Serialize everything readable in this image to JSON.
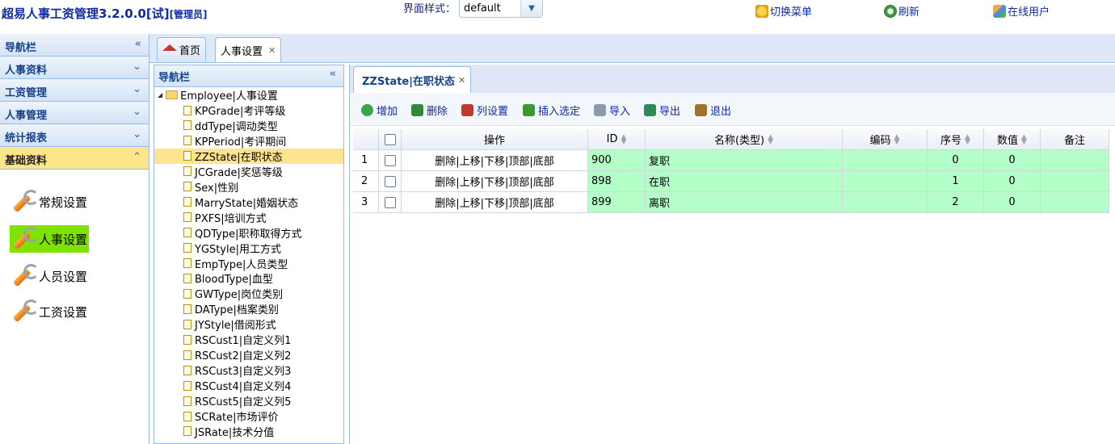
{
  "header": {
    "title": "超易人事工资管理3.2.0.0[试]",
    "role": "[管理员]",
    "style_label": "界面样式：",
    "style_value": "default",
    "buttons": [
      {
        "label": "切换菜单",
        "icon": "switch-menu-icon"
      },
      {
        "label": "刷新",
        "icon": "refresh-icon"
      },
      {
        "label": "在线用户",
        "icon": "online-users-icon"
      }
    ]
  },
  "leftnav": {
    "title": "导航栏",
    "sections": [
      "人事资料",
      "工资管理",
      "人事管理",
      "统计报表",
      "基础资料"
    ],
    "active_section": "基础资料",
    "tools": [
      {
        "label": "常规设置",
        "selected": false
      },
      {
        "label": "人事设置",
        "selected": true
      },
      {
        "label": "人员设置",
        "selected": false
      },
      {
        "label": "工资设置",
        "selected": false
      }
    ]
  },
  "tabs": [
    {
      "label": "首页"
    },
    {
      "label": "人事设置"
    }
  ],
  "tree": {
    "title": "导航栏",
    "root": "Employee|人事设置",
    "items": [
      "KPGrade|考评等级",
      "ddType|调动类型",
      "KPPeriod|考评期间",
      "ZZState|在职状态",
      "JCGrade|奖惩等级",
      "Sex|性别",
      "MarryState|婚姻状态",
      "PXFS|培训方式",
      "QDType|职称取得方式",
      "YGStyle|用工方式",
      "EmpType|人员类型",
      "BloodType|血型",
      "GWType|岗位类别",
      "DAType|档案类别",
      "JYStyle|借阅形式",
      "RSCust1|自定义列1",
      "RSCust2|自定义列2",
      "RSCust3|自定义列3",
      "RSCust4|自定义列4",
      "RSCust5|自定义列5",
      "SCRate|市场评价",
      "JSRate|技术分值"
    ],
    "selected": "ZZState|在职状态"
  },
  "content": {
    "tab": "ZZState|在职状态",
    "toolbar": [
      {
        "label": "增加",
        "icon": "add-icon",
        "color": "#3aa54a"
      },
      {
        "label": "删除",
        "icon": "delete-icon",
        "color": "#2e8b3a"
      },
      {
        "label": "列设置",
        "icon": "column-settings-icon",
        "color": "#c0392b"
      },
      {
        "label": "插入选定",
        "icon": "insert-icon",
        "color": "#3c9a2c"
      },
      {
        "label": "导入",
        "icon": "import-icon",
        "color": "#8a9bb0"
      },
      {
        "label": "导出",
        "icon": "export-icon",
        "color": "#2e8b57"
      },
      {
        "label": "退出",
        "icon": "exit-icon",
        "color": "#a0722a"
      }
    ],
    "columns": [
      "操作",
      "ID",
      "名称(类型)",
      "编码",
      "序号",
      "数值",
      "备注"
    ],
    "rows": [
      {
        "num": "1",
        "ops": "删除|上移|下移|顶部|底部",
        "id": "900",
        "name": "复职",
        "code": "",
        "seq": "0",
        "value": "0",
        "note": ""
      },
      {
        "num": "2",
        "ops": "删除|上移|下移|顶部|底部",
        "id": "898",
        "name": "在职",
        "code": "",
        "seq": "1",
        "value": "0",
        "note": ""
      },
      {
        "num": "3",
        "ops": "删除|上移|下移|顶部|底部",
        "id": "899",
        "name": "离职",
        "code": "",
        "seq": "2",
        "value": "0",
        "note": ""
      }
    ]
  }
}
